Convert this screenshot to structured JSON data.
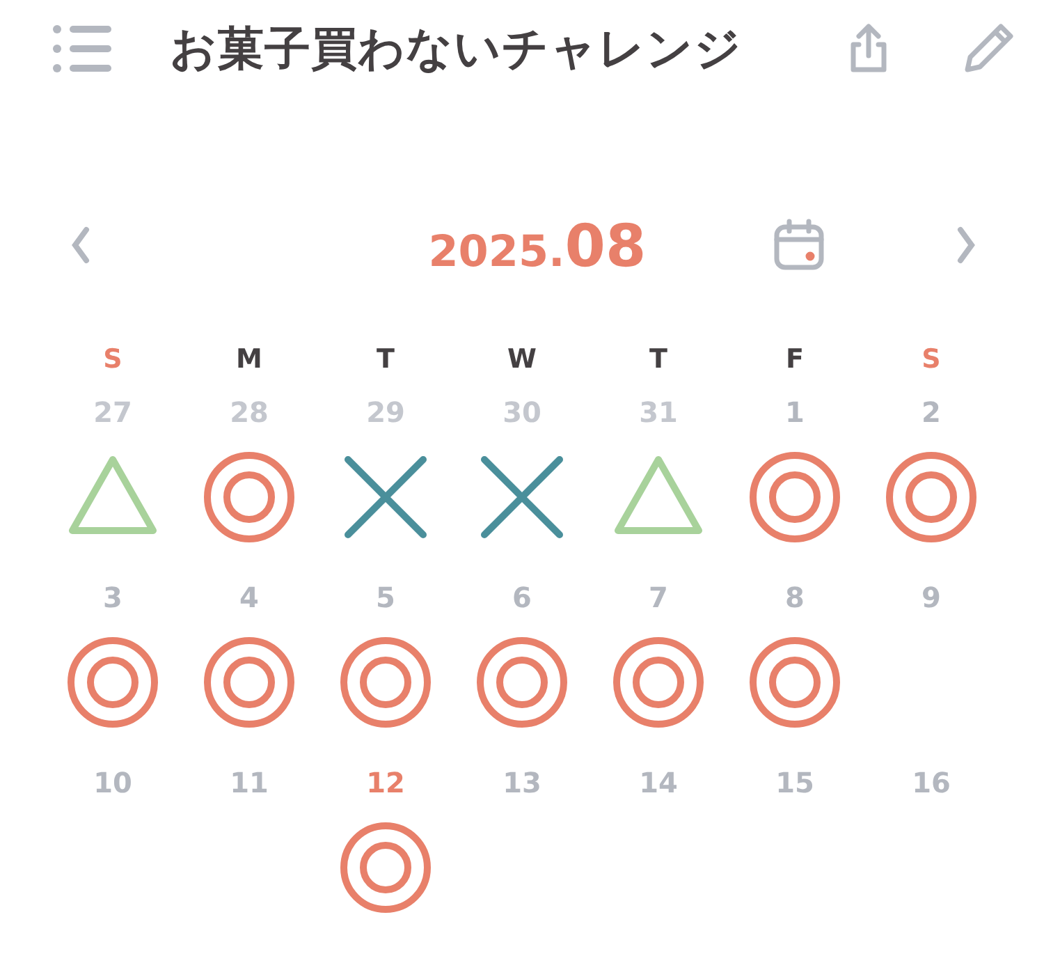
{
  "header": {
    "title": "お菓子買わないチャレンジ"
  },
  "month": {
    "year": "2025.",
    "month": "08"
  },
  "weekdays": [
    {
      "label": "S",
      "weekend": true
    },
    {
      "label": "M",
      "weekend": false
    },
    {
      "label": "T",
      "weekend": false
    },
    {
      "label": "W",
      "weekend": false
    },
    {
      "label": "T",
      "weekend": false
    },
    {
      "label": "F",
      "weekend": false
    },
    {
      "label": "S",
      "weekend": true
    }
  ],
  "weeks": [
    [
      {
        "day": "27",
        "muted": true,
        "today": false,
        "kind": "triangle"
      },
      {
        "day": "28",
        "muted": true,
        "today": false,
        "kind": "double-circle"
      },
      {
        "day": "29",
        "muted": true,
        "today": false,
        "kind": "cross"
      },
      {
        "day": "30",
        "muted": true,
        "today": false,
        "kind": "cross"
      },
      {
        "day": "31",
        "muted": true,
        "today": false,
        "kind": "triangle"
      },
      {
        "day": "1",
        "muted": false,
        "today": false,
        "kind": "double-circle"
      },
      {
        "day": "2",
        "muted": false,
        "today": false,
        "kind": "double-circle"
      }
    ],
    [
      {
        "day": "3",
        "muted": false,
        "today": false,
        "kind": "double-circle"
      },
      {
        "day": "4",
        "muted": false,
        "today": false,
        "kind": "double-circle"
      },
      {
        "day": "5",
        "muted": false,
        "today": false,
        "kind": "double-circle"
      },
      {
        "day": "6",
        "muted": false,
        "today": false,
        "kind": "double-circle"
      },
      {
        "day": "7",
        "muted": false,
        "today": false,
        "kind": "double-circle"
      },
      {
        "day": "8",
        "muted": false,
        "today": false,
        "kind": "double-circle"
      },
      {
        "day": "9",
        "muted": false,
        "today": false
      }
    ],
    [
      {
        "day": "10",
        "muted": false,
        "today": false
      },
      {
        "day": "11",
        "muted": false,
        "today": false
      },
      {
        "day": "12",
        "muted": false,
        "today": true,
        "kind": "double-circle"
      },
      {
        "day": "13",
        "muted": false,
        "today": false
      },
      {
        "day": "14",
        "muted": false,
        "today": false
      },
      {
        "day": "15",
        "muted": false,
        "today": false
      },
      {
        "day": "16",
        "muted": false,
        "today": false
      }
    ]
  ]
}
